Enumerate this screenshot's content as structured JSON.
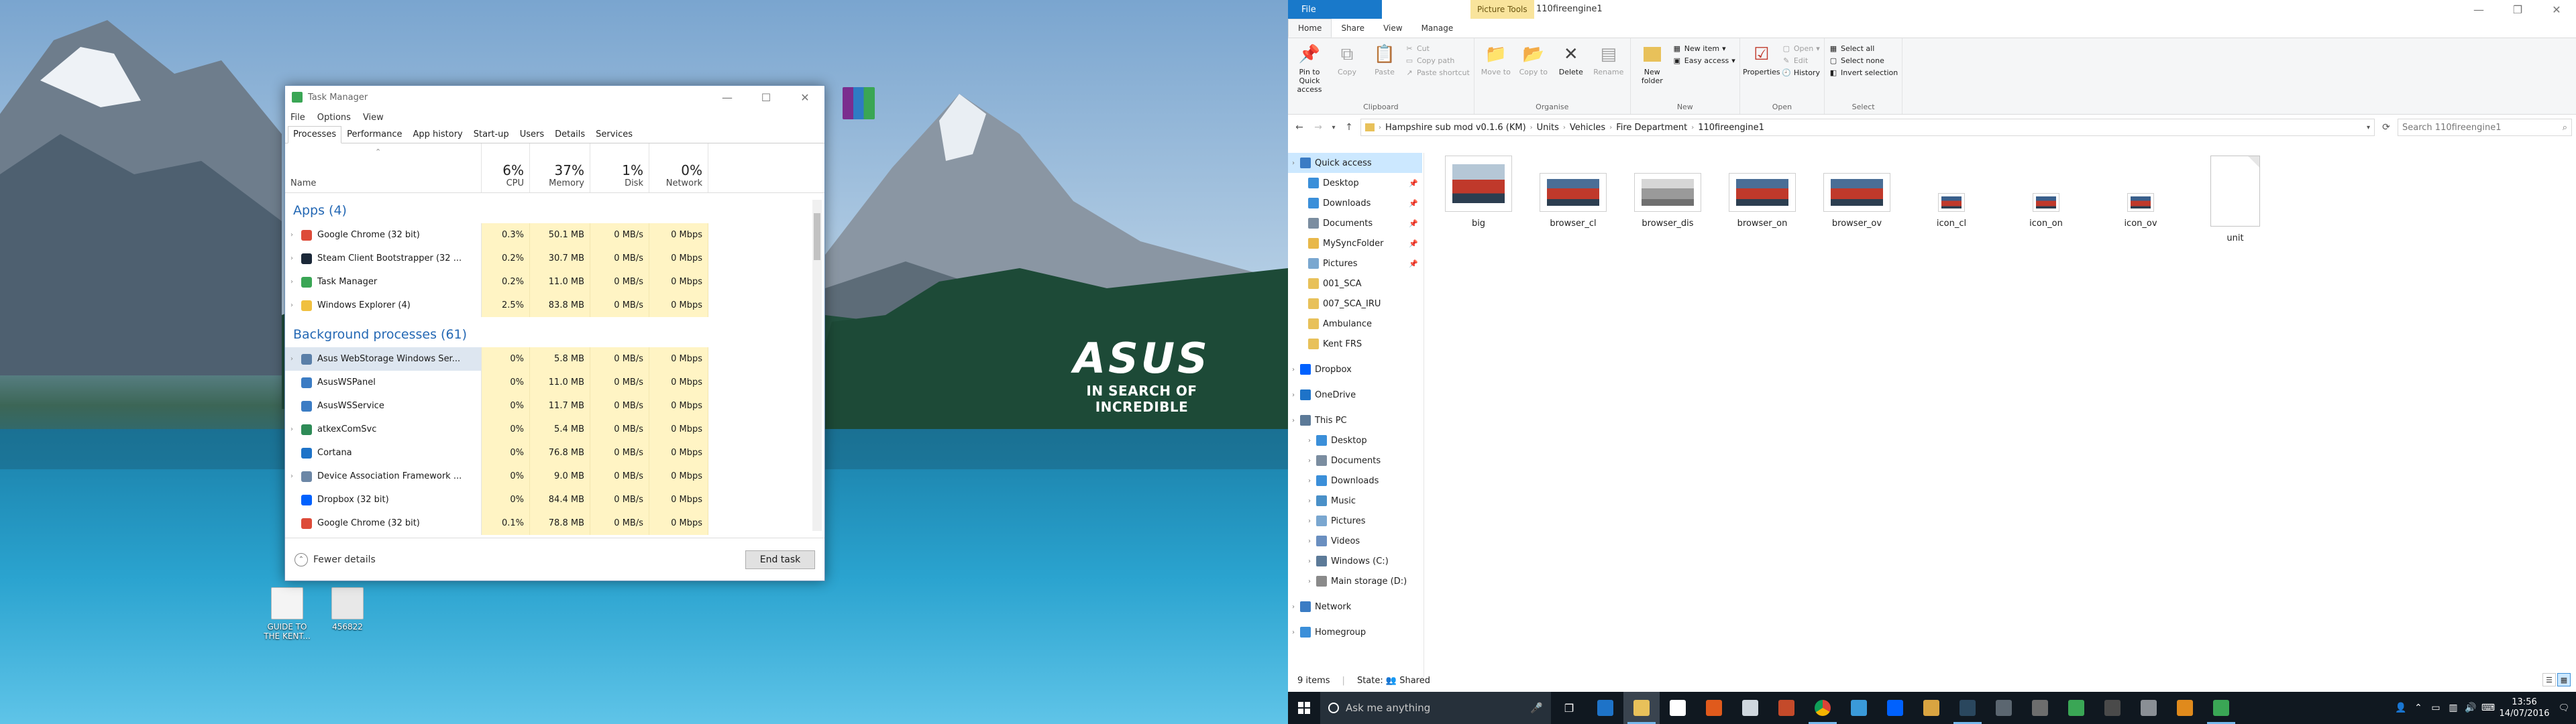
{
  "desktop": {
    "wallpaper": {
      "logo_text": "ASUS",
      "tagline": "IN SEARCH OF INCREDIBLE"
    },
    "icons": [
      {
        "label": "GUIDE TO THE KENT...",
        "color": "#ffffff"
      },
      {
        "label": "456822",
        "color": "#ffffff"
      }
    ]
  },
  "task_manager": {
    "title": "Task Manager",
    "menu": [
      "File",
      "Options",
      "View"
    ],
    "tabs": [
      "Processes",
      "Performance",
      "App history",
      "Start-up",
      "Users",
      "Details",
      "Services"
    ],
    "active_tab": "Processes",
    "columns": {
      "name": "Name",
      "cpu": {
        "pct": "6%",
        "label": "CPU"
      },
      "memory": {
        "pct": "37%",
        "label": "Memory"
      },
      "disk": {
        "pct": "1%",
        "label": "Disk"
      },
      "network": {
        "pct": "0%",
        "label": "Network"
      }
    },
    "apps_header": "Apps (4)",
    "apps": [
      {
        "name": "Google Chrome (32 bit)",
        "cpu": "0.3%",
        "mem": "50.1 MB",
        "disk": "0 MB/s",
        "net": "0 Mbps",
        "icon_color": "#dd4b39",
        "expandable": true
      },
      {
        "name": "Steam Client Bootstrapper (32 ...",
        "cpu": "0.2%",
        "mem": "30.7 MB",
        "disk": "0 MB/s",
        "net": "0 Mbps",
        "icon_color": "#1b2838",
        "expandable": true
      },
      {
        "name": "Task Manager",
        "cpu": "0.2%",
        "mem": "11.0 MB",
        "disk": "0 MB/s",
        "net": "0 Mbps",
        "icon_color": "#3aa655",
        "expandable": true
      },
      {
        "name": "Windows Explorer (4)",
        "cpu": "2.5%",
        "mem": "83.8 MB",
        "disk": "0 MB/s",
        "net": "0 Mbps",
        "icon_color": "#f0c040",
        "expandable": true
      }
    ],
    "bg_header": "Background processes (61)",
    "background": [
      {
        "name": "Asus WebStorage Windows Ser...",
        "cpu": "0%",
        "mem": "5.8 MB",
        "disk": "0 MB/s",
        "net": "0 Mbps",
        "icon_color": "#5a7fa8",
        "expandable": true,
        "selected": true
      },
      {
        "name": "AsusWSPanel",
        "cpu": "0%",
        "mem": "11.0 MB",
        "disk": "0 MB/s",
        "net": "0 Mbps",
        "icon_color": "#3b7cc4",
        "expandable": false
      },
      {
        "name": "AsusWSService",
        "cpu": "0%",
        "mem": "11.7 MB",
        "disk": "0 MB/s",
        "net": "0 Mbps",
        "icon_color": "#3b7cc4",
        "expandable": false
      },
      {
        "name": "atkexComSvc",
        "cpu": "0%",
        "mem": "5.4 MB",
        "disk": "0 MB/s",
        "net": "0 Mbps",
        "icon_color": "#2e8b57",
        "expandable": true
      },
      {
        "name": "Cortana",
        "cpu": "0%",
        "mem": "76.8 MB",
        "disk": "0 MB/s",
        "net": "0 Mbps",
        "icon_color": "#1e73c8",
        "expandable": false
      },
      {
        "name": "Device Association Framework ...",
        "cpu": "0%",
        "mem": "9.0 MB",
        "disk": "0 MB/s",
        "net": "0 Mbps",
        "icon_color": "#6c87a6",
        "expandable": true
      },
      {
        "name": "Dropbox (32 bit)",
        "cpu": "0%",
        "mem": "84.4 MB",
        "disk": "0 MB/s",
        "net": "0 Mbps",
        "icon_color": "#0061fe",
        "expandable": false
      },
      {
        "name": "Google Chrome (32 bit)",
        "cpu": "0.1%",
        "mem": "78.8 MB",
        "disk": "0 MB/s",
        "net": "0 Mbps",
        "icon_color": "#dd4b39",
        "expandable": false
      }
    ],
    "fewer_details": "Fewer details",
    "end_task": "End task"
  },
  "explorer": {
    "picture_tools": "Picture Tools",
    "title": "110fireengine1",
    "ribbon_tabs": [
      "File",
      "Home",
      "Share",
      "View",
      "Manage"
    ],
    "active_ribbon_tab": "Home",
    "ribbon": {
      "clipboard": {
        "name": "Clipboard",
        "pin": "Pin to Quick access",
        "copy": "Copy",
        "paste": "Paste",
        "cut": "Cut",
        "copy_path": "Copy path",
        "paste_shortcut": "Paste shortcut"
      },
      "organise": {
        "name": "Organise",
        "move_to": "Move to",
        "copy_to": "Copy to",
        "delete": "Delete",
        "rename": "Rename"
      },
      "new": {
        "name": "New",
        "new_folder": "New folder",
        "new_item": "New item",
        "easy_access": "Easy access"
      },
      "open": {
        "name": "Open",
        "properties": "Properties",
        "open": "Open",
        "edit": "Edit",
        "history": "History"
      },
      "select": {
        "name": "Select",
        "select_all": "Select all",
        "select_none": "Select none",
        "invert": "Invert selection"
      }
    },
    "breadcrumb": [
      "Hampshire sub mod v0.1.6 (KM)",
      "Units",
      "Vehicles",
      "Fire Department",
      "110fireengine1"
    ],
    "search_placeholder": "Search 110fireengine1",
    "nav": {
      "quick_access": "Quick access",
      "quick_items": [
        {
          "label": "Desktop",
          "pinned": true,
          "color": "#3b8fd9"
        },
        {
          "label": "Downloads",
          "pinned": true,
          "color": "#3b8fd9"
        },
        {
          "label": "Documents",
          "pinned": true,
          "color": "#7b8da0"
        },
        {
          "label": "MySyncFolder",
          "pinned": true,
          "color": "#e8b84a"
        },
        {
          "label": "Pictures",
          "pinned": true,
          "color": "#7aa7d0"
        },
        {
          "label": "001_SCA",
          "pinned": false,
          "color": "#e8c15a"
        },
        {
          "label": "007_SCA_IRU",
          "pinned": false,
          "color": "#e8c15a"
        },
        {
          "label": "Ambulance",
          "pinned": false,
          "color": "#e8c15a"
        },
        {
          "label": "Kent FRS",
          "pinned": false,
          "color": "#e8c15a"
        }
      ],
      "dropbox": "Dropbox",
      "onedrive": "OneDrive",
      "this_pc": "This PC",
      "pc_items": [
        {
          "label": "Desktop",
          "color": "#3b8fd9"
        },
        {
          "label": "Documents",
          "color": "#7b8da0"
        },
        {
          "label": "Downloads",
          "color": "#3b8fd9"
        },
        {
          "label": "Music",
          "color": "#4a90c8"
        },
        {
          "label": "Pictures",
          "color": "#7aa7d0"
        },
        {
          "label": "Videos",
          "color": "#6a8fc0"
        },
        {
          "label": "Windows (C:)",
          "color": "#5c7a98"
        },
        {
          "label": "Main storage (D:)",
          "color": "#8a8a8a"
        }
      ],
      "network": "Network",
      "homegroup": "Homegroup"
    },
    "files": [
      {
        "name": "big",
        "kind": "big"
      },
      {
        "name": "browser_cl",
        "kind": "browser"
      },
      {
        "name": "browser_dis",
        "kind": "browser_dis"
      },
      {
        "name": "browser_on",
        "kind": "browser"
      },
      {
        "name": "browser_ov",
        "kind": "browser"
      },
      {
        "name": "icon_cl",
        "kind": "icon"
      },
      {
        "name": "icon_on",
        "kind": "icon"
      },
      {
        "name": "icon_ov",
        "kind": "icon"
      },
      {
        "name": "unit",
        "kind": "doc"
      }
    ],
    "status": {
      "count": "9 items",
      "state": "State:",
      "shared": "Shared"
    }
  },
  "taskbar": {
    "search_placeholder": "Ask me anything",
    "date_time": {
      "time": "13:56",
      "date": "14/07/2016"
    }
  }
}
